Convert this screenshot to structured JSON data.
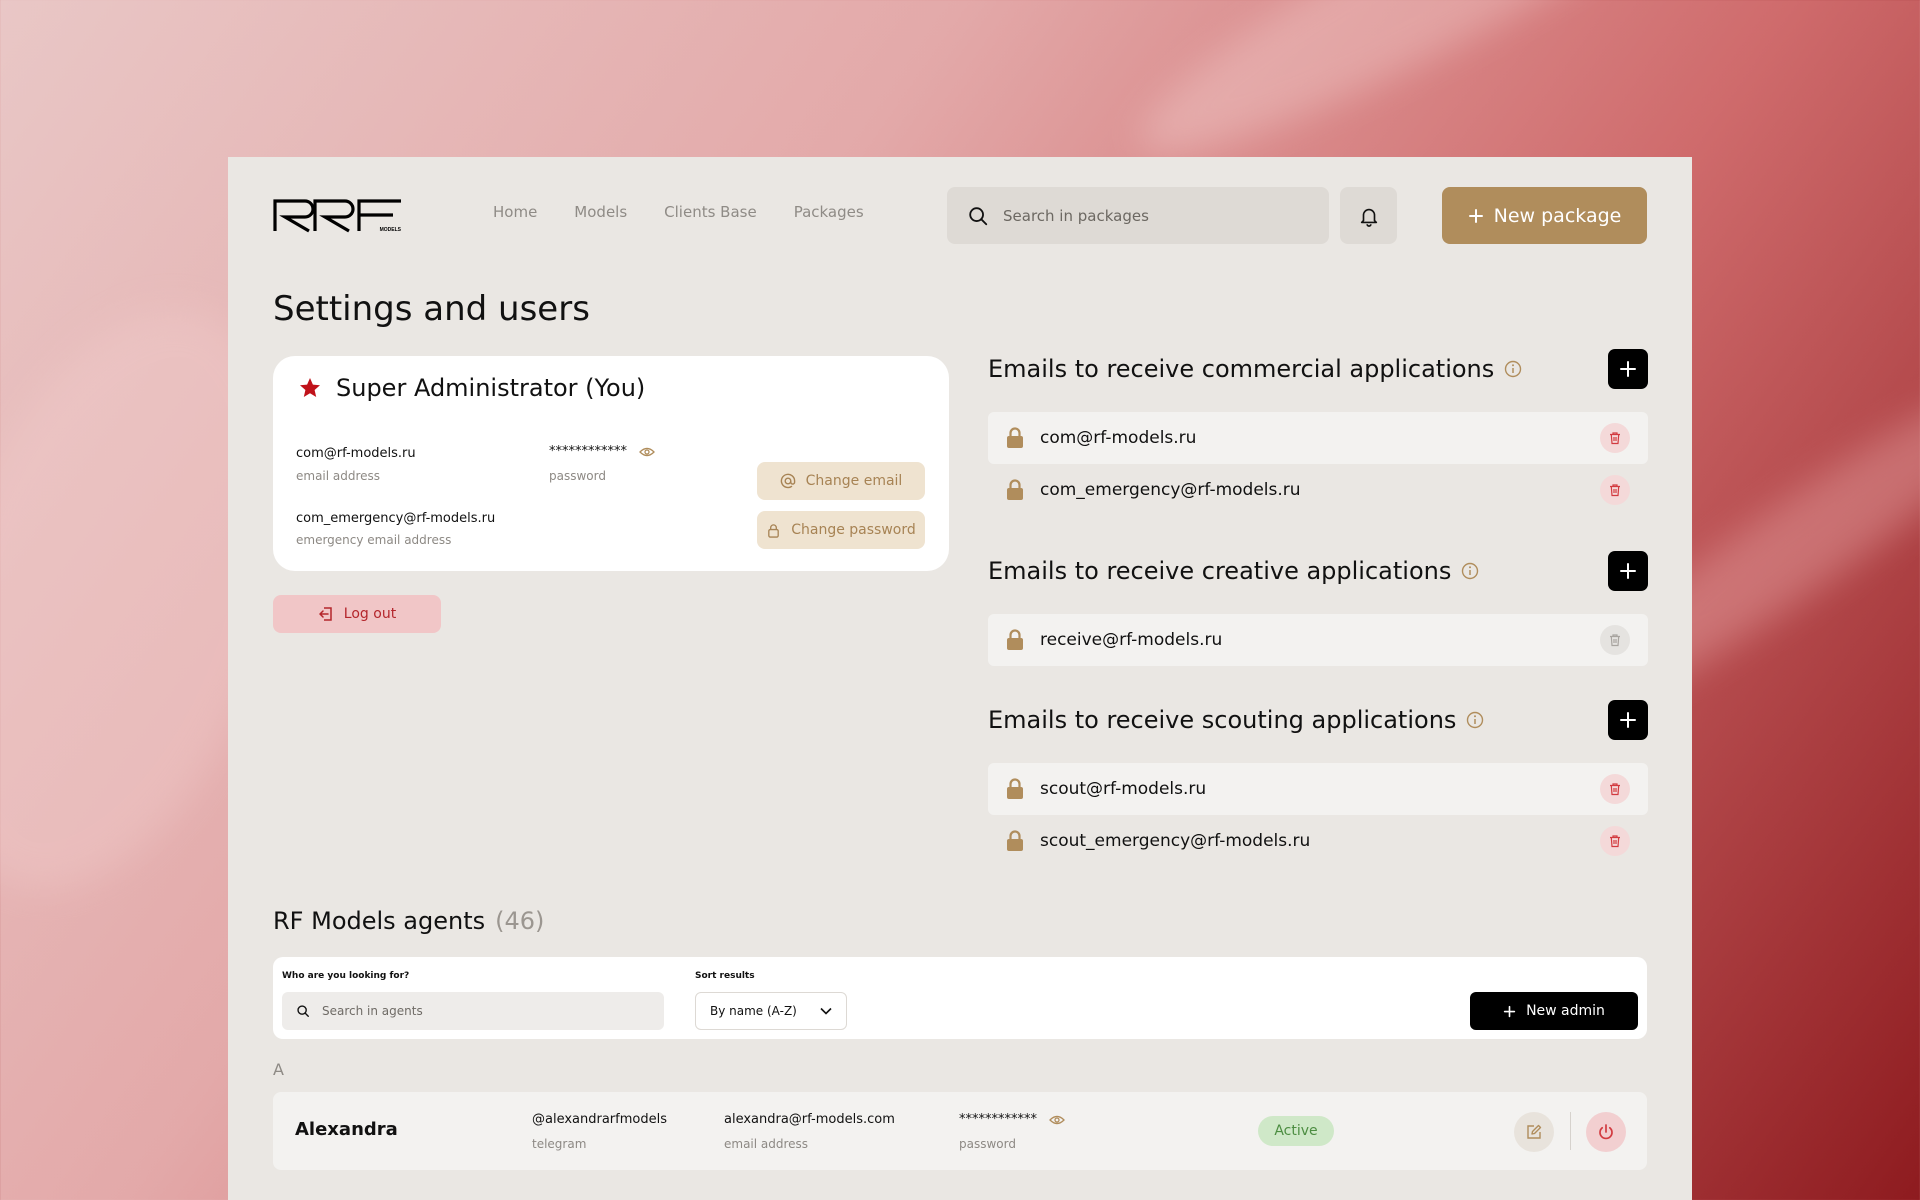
{
  "brand": {
    "logo_text": "RF",
    "logo_sub": "MODELS"
  },
  "nav": {
    "items": [
      "Home",
      "Models",
      "Clients Base",
      "Packages"
    ]
  },
  "search": {
    "placeholder": "Search in packages"
  },
  "header": {
    "new_package_label": "New package"
  },
  "page": {
    "title": "Settings and users"
  },
  "admin": {
    "title": "Super Administrator (You)",
    "email": "com@rf-models.ru",
    "email_label": "email address",
    "password_mask": "************",
    "password_label": "password",
    "emergency_email": "com_emergency@rf-models.ru",
    "emergency_label": "emergency email address",
    "change_email_label": "Change email",
    "change_password_label": "Change password"
  },
  "logout_label": "Log out",
  "email_sections": [
    {
      "title": "Emails to receive commercial applications",
      "emails": [
        "com@rf-models.ru",
        "com_emergency@rf-models.ru"
      ]
    },
    {
      "title": "Emails to receive creative applications",
      "emails": [
        "receive@rf-models.ru"
      ]
    },
    {
      "title": "Emails to receive scouting applications",
      "emails": [
        "scout@rf-models.ru",
        "scout_emergency@rf-models.ru"
      ]
    }
  ],
  "agents": {
    "title": "RF Models agents",
    "count": "(46)",
    "search_label": "Who are you looking for?",
    "search_placeholder": "Search in agents",
    "sort_label": "Sort results",
    "sort_value": "By name (A-Z)",
    "new_admin_label": "New admin",
    "group_letter": "A",
    "rows": [
      {
        "name": "Alexandra",
        "telegram": "@alexandrarfmodels",
        "telegram_label": "telegram",
        "email": "alexandra@rf-models.com",
        "email_label": "email address",
        "password_mask": "************",
        "password_label": "password",
        "status": "Active"
      }
    ]
  },
  "colors": {
    "accent_gold": "#b08d5c",
    "danger_red": "#b4262c",
    "panel_bg": "#eae7e3",
    "status_green": "#4c8d41"
  }
}
